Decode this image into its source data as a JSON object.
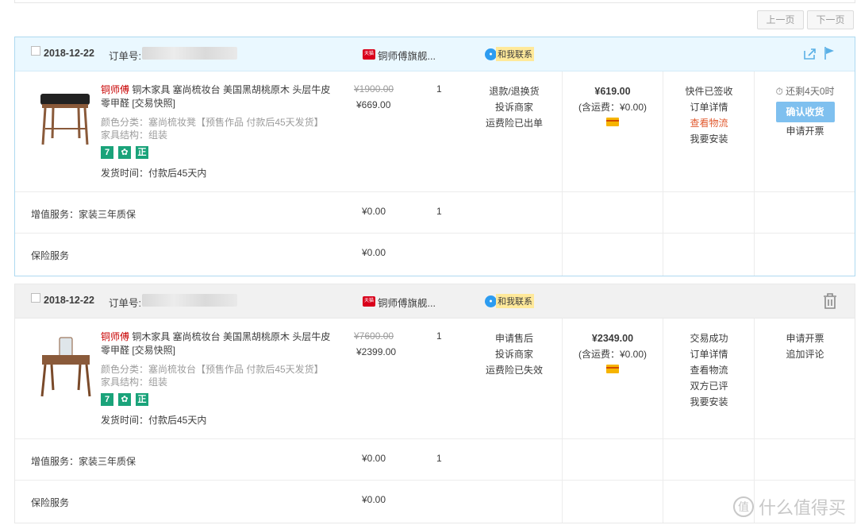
{
  "pager": {
    "prev": "上一页",
    "next": "下一页"
  },
  "orders": [
    {
      "date": "2018-12-22",
      "order_label": "订单号:",
      "shop": "铜师傅旗舰...",
      "shop_badge": "天猫",
      "chat": "和我联系",
      "product": {
        "brand": "铜师傅",
        "name": " 铜木家具 塞尚梳妆台 美国黑胡桃原木 头层牛皮零甲醛 [交易快照]",
        "color": "颜色分类：塞尚梳妆凳【预售作品 付款后45天发货】",
        "structure": "家具结构：组装",
        "badges": [
          "7",
          "",
          "正"
        ],
        "ship_time": "发货时间：付款后45天内",
        "orig_price": "¥1900.00",
        "price": "¥669.00",
        "qty": "1",
        "services": [
          "退款/退换货",
          "投诉商家",
          "运费险已出单"
        ]
      },
      "extras": [
        {
          "label": "增值服务：家装三年质保",
          "price": "¥0.00",
          "qty": "1"
        },
        {
          "label": "保险服务",
          "price": "¥0.00",
          "qty": ""
        }
      ],
      "total": "¥619.00",
      "shipping": "(含运费：¥0.00)",
      "status": [
        "快件已签收",
        "订单详情",
        "查看物流",
        "我要安装"
      ],
      "status_highlight": 2,
      "timer": "还剩4天0时",
      "confirm": "确认收货",
      "ops": [
        "申请开票"
      ]
    },
    {
      "date": "2018-12-22",
      "order_label": "订单号:",
      "shop": "铜师傅旗舰...",
      "shop_badge": "天猫",
      "chat": "和我联系",
      "product": {
        "brand": "铜师傅",
        "name": " 铜木家具 塞尚梳妆台 美国黑胡桃原木 头层牛皮零甲醛 [交易快照]",
        "color": "颜色分类：塞尚梳妆台【预售作品 付款后45天发货】",
        "structure": "家具结构：组装",
        "badges": [
          "7",
          "",
          "正"
        ],
        "ship_time": "发货时间：付款后45天内",
        "orig_price": "¥7600.00",
        "price": "¥2399.00",
        "qty": "1",
        "services": [
          "申请售后",
          "投诉商家",
          "运费险已失效"
        ]
      },
      "extras": [
        {
          "label": "增值服务：家装三年质保",
          "price": "¥0.00",
          "qty": "1"
        },
        {
          "label": "保险服务",
          "price": "¥0.00",
          "qty": ""
        }
      ],
      "total": "¥2349.00",
      "shipping": "(含运费：¥0.00)",
      "status": [
        "交易成功",
        "订单详情",
        "查看物流",
        "双方已评",
        "我要安装"
      ],
      "ops": [
        "申请开票",
        "追加评论"
      ]
    }
  ],
  "watermark": "什么值得买"
}
